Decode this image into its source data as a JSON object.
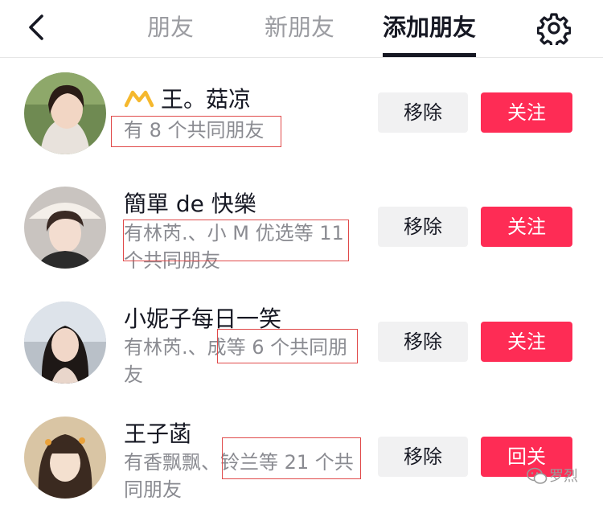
{
  "header": {
    "tabs": [
      {
        "label": "朋友",
        "active": false
      },
      {
        "label": "新朋友",
        "active": false
      },
      {
        "label": "添加朋友",
        "active": true
      }
    ],
    "back_icon": "back-icon",
    "settings_icon": "gear-icon"
  },
  "colors": {
    "follow_button": "#fe2c55",
    "remove_button": "#f1f1f2",
    "highlight_box": "#e04a4a",
    "secondary_text": "#8a8b91"
  },
  "suggestions": [
    {
      "name": "王。菇凉",
      "badge_icon": "crown-icon",
      "mutual": "有 8 个共同朋友",
      "remove_label": "移除",
      "action_label": "关注"
    },
    {
      "name": "簡單 de 快樂",
      "mutual": "有林芮.、小 M 优选等 11 个共同朋友",
      "remove_label": "移除",
      "action_label": "关注"
    },
    {
      "name": "小妮子每日一笑",
      "mutual": "有林芮.、成等 6 个共同朋友",
      "remove_label": "移除",
      "action_label": "关注"
    },
    {
      "name": "王子菡",
      "mutual": "有香飘飘、铃兰等 21 个共同朋友",
      "remove_label": "移除",
      "action_label": "回关"
    }
  ],
  "watermark": {
    "text": "罗烈",
    "icon": "wechat-icon"
  }
}
